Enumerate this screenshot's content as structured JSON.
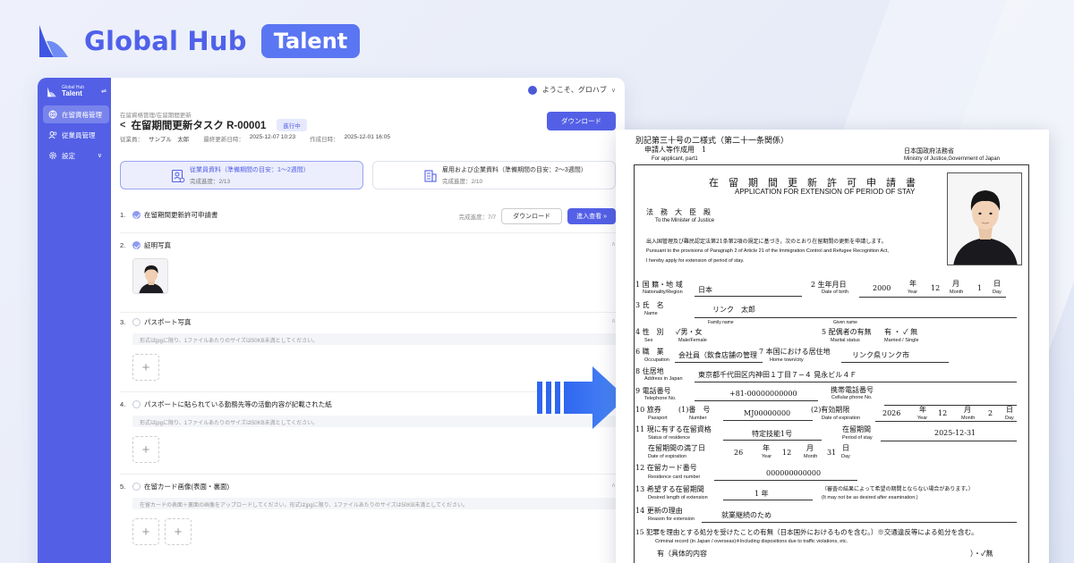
{
  "brand": {
    "name": "Global Hub",
    "badge": "Talent",
    "logo_icon": "global-hub-logo-icon"
  },
  "sidebar": {
    "brand_small": "Global Hub",
    "brand_big": "Talent",
    "items": [
      {
        "label": "在留資格管理",
        "icon": "globe-icon",
        "active": true
      },
      {
        "label": "従業員管理",
        "icon": "users-icon",
        "active": false
      },
      {
        "label": "設定",
        "icon": "gear-icon",
        "active": false,
        "chevron": "∨"
      }
    ]
  },
  "topbar": {
    "greeting": "ようこそ、グロハブ",
    "dropdown": "∨"
  },
  "task": {
    "breadcrumb": "在留資格管理/在留期間更新",
    "back": "<",
    "title": "在留期間更新タスク R-00001",
    "status": "進行中",
    "employee_label": "従業員：",
    "employee": "サンプル　太郎",
    "updated_label": "最終更新日時：",
    "updated": "2025-12-07 10:23",
    "created_label": "作成日時：",
    "created": "2025-12-01 16:05",
    "download_label": "ダウンロード"
  },
  "categories": [
    {
      "label": "従業員資料（準備期間の目安：1～2週間）",
      "progress": "完成進度：2/13",
      "active": true
    },
    {
      "label": "雇用および企業資料（準備期間の目安：2～3週間）",
      "progress": "完成進度：2/10",
      "active": false
    }
  ],
  "items": [
    {
      "num": "1.",
      "text": "在留期間更新許可申請書",
      "done": true,
      "progress": "完成進度：7/7",
      "download": "ダウンロード",
      "go": "進入查看 »"
    },
    {
      "num": "2.",
      "text": "証明写真",
      "done": true
    },
    {
      "num": "3.",
      "text": "パスポート写真",
      "done": false,
      "hint": "形式はjpgに限り、1ファイルあたりのサイズは50KB未満としてください。"
    },
    {
      "num": "4.",
      "text": "パスポートに貼られている勤務先等の活動内容が記載された紙",
      "done": false,
      "hint": "形式はjpgに限り、1ファイルあたりのサイズは50KB未満としてください。"
    },
    {
      "num": "5.",
      "text": "在留カード画像(表面・裏面)",
      "done": false,
      "hint": "在留カードの表面＋裏面の画像をアップロードしてください。形式はjpgに限り、1ファイルあたりのサイズは50KB未満としてください。"
    }
  ],
  "upload_plus": "+",
  "colors": {
    "primary": "#5360e6",
    "brand_text": "#4f61ea",
    "badge": "#5b76f2",
    "arrow": "#3f7cf0"
  },
  "document": {
    "form_no": "別記第三十号の二様式（第二十一条関係）",
    "applicant_jp": "申請人等作成用　1",
    "applicant_en": "For applicant, part1",
    "govt_jp": "日本国政府法務省",
    "govt_en": "Ministry of Justice,Government of Japan",
    "title_jp": "在　留　期　間　更　新　許　可　申　請　書",
    "title_en": "APPLICATION FOR EXTENSION OF PERIOD OF STAY",
    "to_jp": "法　務　大　臣　殿",
    "to_en": "To the Minister of Justice",
    "pursuant_jp": "出入国管理及び難民認定法第21条第2項の規定に基づき，次のとおり在留期間の更新を申請します。",
    "pursuant_en1": "Pursuant to the provisions of Paragraph 2 of Article 21 of the Immigration Control and Refugee Recognition Act,",
    "pursuant_en2": "I hereby apply for extension of period of stay.",
    "f1_jp": "国 籍・地 域",
    "f1_en": "Nationality/Region",
    "f1_val": "日本",
    "f2_jp": "生年月日",
    "f2_en": "Date of birth",
    "f2_y": "2000",
    "f2_m": "12",
    "f2_d": "1",
    "year_jp": "年",
    "year_en": "Year",
    "month_jp": "月",
    "month_en": "Month",
    "day_jp": "日",
    "day_en": "Day",
    "f3_jp": "氏　名",
    "f3_en": "Name",
    "f3_val": "リンク　太郎",
    "family": "Family name",
    "given": "Given name",
    "f4_jp": "性　別",
    "f4_val": "✓男・女",
    "f4_en": "Sex",
    "f4_en2": "Male/Female",
    "f5_jp": "配偶者の有無",
    "f5_val": "有 ・ ✓ 無",
    "f5_en": "Marital status",
    "f5_en2": "Married / Single",
    "f6_jp": "職　業",
    "f6_en": "Occupation",
    "f6_val": "会社員（飲食店舗の管理",
    "f7_jp": "本国における居住地",
    "f7_en": "Home town/city",
    "f7_val": "リンク県リンク市",
    "f8_jp": "住居地",
    "f8_en": "Address in Japan",
    "f8_val": "東京都千代田区内神田１丁目７−４ 晃永ビル４Ｆ",
    "f9_jp": "電話番号",
    "f9_en": "Telephone No.",
    "f9_val": "+81-00000000000",
    "f9b_jp": "携帯電話番号",
    "f9b_en": "Cellular phone No.",
    "f10_jp": "旅券",
    "f10_en": "Passport",
    "f10_num_jp": "(1)番　号",
    "f10_num_en": "Number",
    "f10_val": "MJ00000000",
    "f10_exp_jp": "(2)有効期限",
    "f10_exp_en": "Date of expiration",
    "f10_y": "2026",
    "f10_m": "12",
    "f10_d": "2",
    "f11_jp": "現に有する在留資格",
    "f11_en": "Status of residence",
    "f11_val": "特定技能1号",
    "f11_per_jp": "在留期間",
    "f11_per_en": "Period of stay",
    "f11_per_val": "2025-12-31",
    "f11_exp_jp": "在留期間の満了日",
    "f11_exp_en": "Date of expiration",
    "f11_y": "26",
    "f11_m": "12",
    "f11_d": "31",
    "f12_jp": "在留カード番号",
    "f12_en": "Residence card number",
    "f12_val": "000000000000",
    "f13_jp": "希望する在留期間",
    "f13_en": "Desired length of extension",
    "f13_val": "1 年",
    "f13_note_jp": "（審査の結果によって希望の期間とならない場合があります。）",
    "f13_note_en": "(It may not be as desired after examination.)",
    "f14_jp": "更新の理由",
    "f14_en": "Reason for extension",
    "f14_val": "就業継続のため",
    "f15_jp": "犯罪を理由とする処分を受けたことの有無（日本国外におけるものを含む。）※交通違反等による処分を含む。",
    "f15_en": "Criminal record (in Japan / overseas)※Including dispositions due to traffic violations, etc.",
    "f15_b_jp": "有（具体的内容",
    "f15_b_val": "）・✓無"
  }
}
